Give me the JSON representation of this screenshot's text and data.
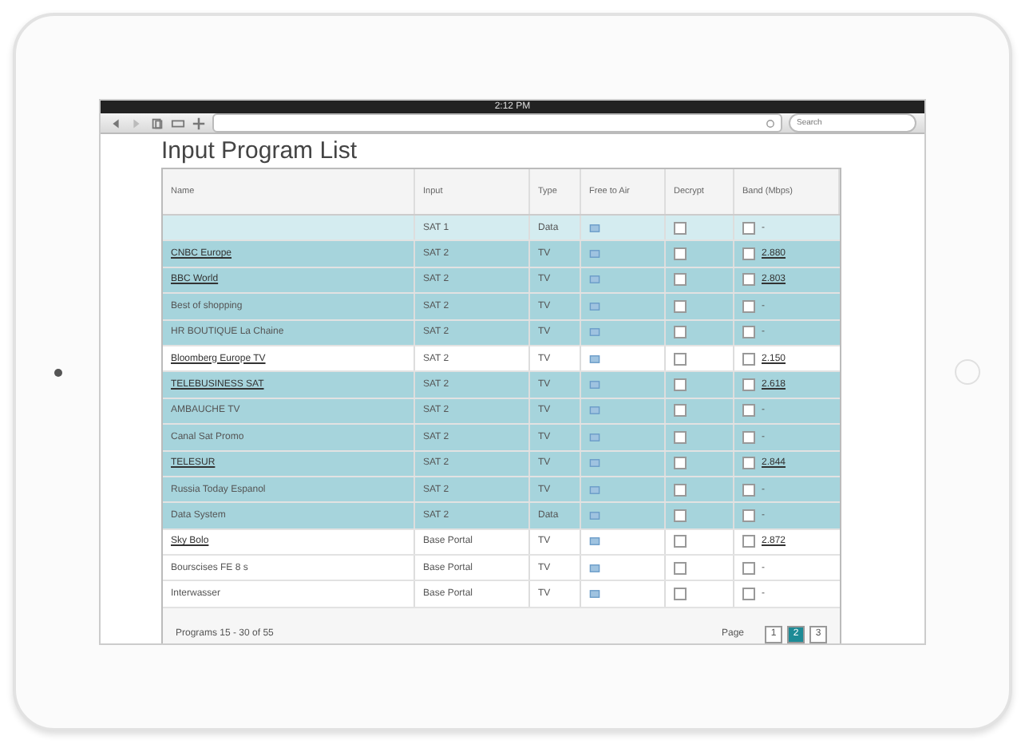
{
  "status_bar": {
    "time": "2:12 PM"
  },
  "browser": {
    "search": {
      "placeholder": "Search"
    }
  },
  "page_title": "Input Program List",
  "table": {
    "columns": [
      "Name",
      "Input",
      "Type",
      "Free to Air",
      "Decrypt",
      "Band (Mbps)"
    ],
    "rows": [
      {
        "name": "",
        "input": "SAT 1",
        "type": "Data",
        "band": "-",
        "selected": false,
        "highlighted": true,
        "link": false
      },
      {
        "name": "CNBC Europe",
        "input": "SAT 2",
        "type": "TV",
        "band": "2.880",
        "selected": true,
        "highlighted": true,
        "link": true
      },
      {
        "name": "BBC World",
        "input": "SAT 2",
        "type": "TV",
        "band": "2.803",
        "selected": true,
        "highlighted": true,
        "link": true
      },
      {
        "name": "Best of shopping",
        "input": "SAT 2",
        "type": "TV",
        "band": "-",
        "selected": true,
        "highlighted": true,
        "link": false
      },
      {
        "name": "HR BOUTIQUE La Chaine",
        "input": "SAT 2",
        "type": "TV",
        "band": "-",
        "selected": true,
        "highlighted": true,
        "link": false
      },
      {
        "name": "Bloomberg Europe TV",
        "input": "SAT 2",
        "type": "TV",
        "band": "2.150",
        "selected": false,
        "highlighted": false,
        "link": true
      },
      {
        "name": "TELEBUSINESS SAT",
        "input": "SAT 2",
        "type": "TV",
        "band": "2.618",
        "selected": true,
        "highlighted": true,
        "link": true
      },
      {
        "name": "AMBAUCHE TV",
        "input": "SAT 2",
        "type": "TV",
        "band": "-",
        "selected": true,
        "highlighted": true,
        "link": false
      },
      {
        "name": "Canal Sat Promo",
        "input": "SAT 2",
        "type": "TV",
        "band": "-",
        "selected": true,
        "highlighted": true,
        "link": false
      },
      {
        "name": "TELESUR",
        "input": "SAT 2",
        "type": "TV",
        "band": "2.844",
        "selected": true,
        "highlighted": true,
        "link": true
      },
      {
        "name": "Russia Today Espanol",
        "input": "SAT 2",
        "type": "TV",
        "band": "-",
        "selected": true,
        "highlighted": true,
        "link": false
      },
      {
        "name": "Data System",
        "input": "SAT 2",
        "type": "Data",
        "band": "-",
        "selected": true,
        "highlighted": true,
        "link": false
      },
      {
        "name": "Sky Bolo",
        "input": "Base Portal",
        "type": "TV",
        "band": "2.872",
        "selected": false,
        "highlighted": false,
        "link": true
      },
      {
        "name": "Bourscises FE 8 s",
        "input": "Base Portal",
        "type": "TV",
        "band": "-",
        "selected": false,
        "highlighted": false,
        "link": false
      },
      {
        "name": "Interwasser",
        "input": "Base Portal",
        "type": "TV",
        "band": "-",
        "selected": false,
        "highlighted": false,
        "link": false
      }
    ]
  },
  "footer": {
    "summary": "Programs 15 - 30 of 55",
    "page_label": "Page",
    "pages": [
      {
        "label": "1",
        "selected": false
      },
      {
        "label": "2",
        "selected": true
      },
      {
        "label": "3",
        "selected": false
      }
    ]
  }
}
